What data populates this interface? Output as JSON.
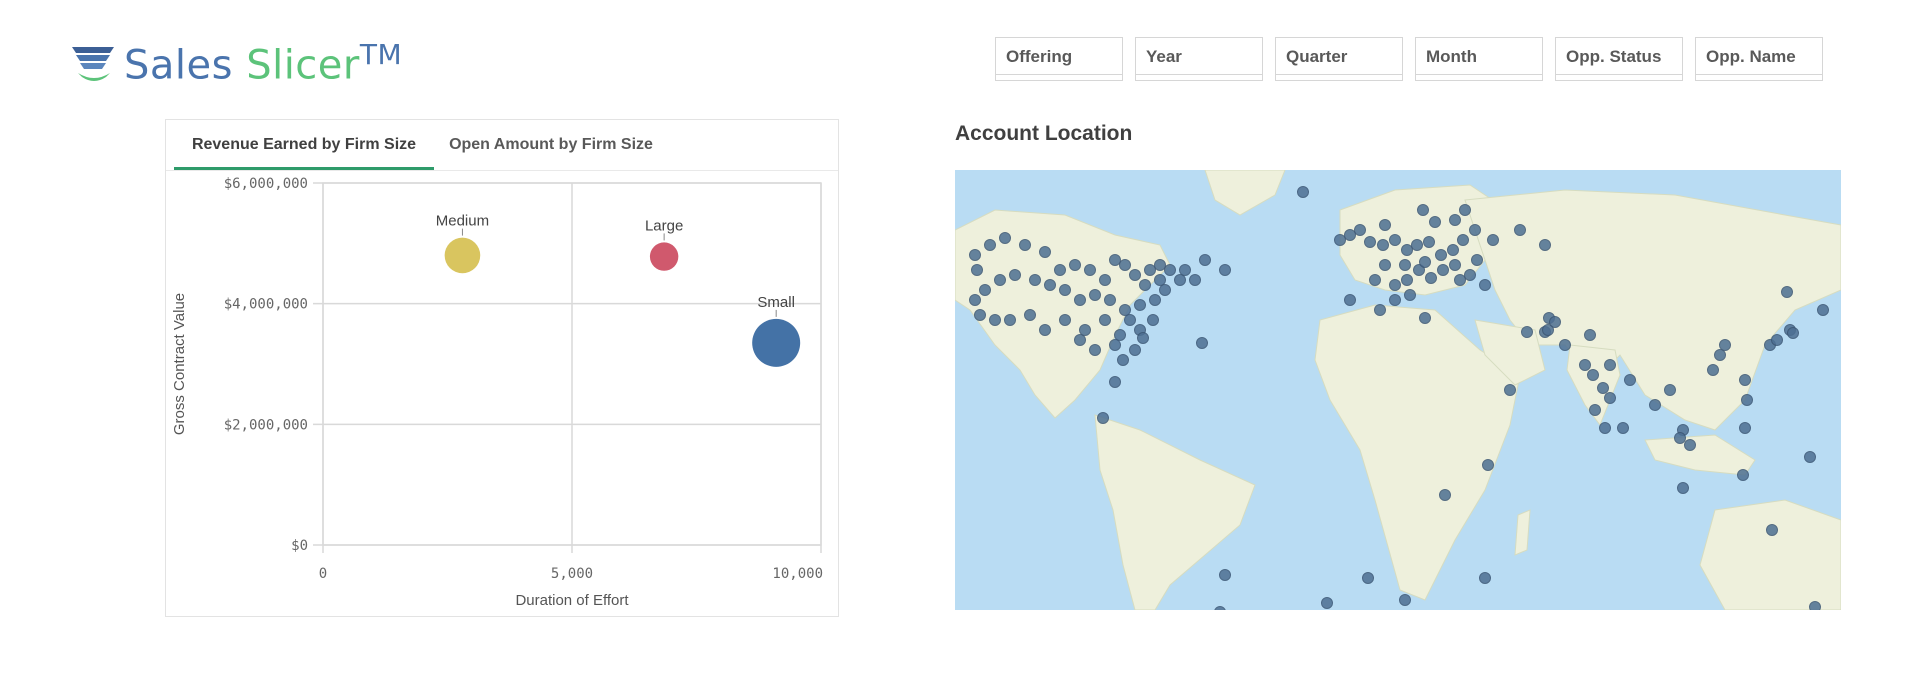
{
  "brand": {
    "part1": "Sales ",
    "part2": "Slicer",
    "tm": "TM"
  },
  "filters": [
    {
      "label": "Offering"
    },
    {
      "label": "Year"
    },
    {
      "label": "Quarter"
    },
    {
      "label": "Month"
    },
    {
      "label": "Opp. Status"
    },
    {
      "label": "Opp. Name"
    }
  ],
  "tabs": [
    {
      "label": "Revenue Earned by Firm Size",
      "active": true
    },
    {
      "label": "Open Amount by Firm Size",
      "active": false
    }
  ],
  "map": {
    "title": "Account Location"
  },
  "colors": {
    "accent": "#2e9b6a",
    "small": "#4472a6",
    "medium": "#d9c55f",
    "large": "#d0596d",
    "water": "#b9dcf3",
    "land": "#eef0dc",
    "dot": "#4d6f92"
  },
  "chart_data": {
    "type": "scatter",
    "xlabel": "Duration of Effort",
    "ylabel": "Gross Contract Value",
    "xlim": [
      0,
      10000
    ],
    "ylim": [
      0,
      6000000
    ],
    "xticks": [
      {
        "v": 0,
        "label": "0"
      },
      {
        "v": 5000,
        "label": "5,000"
      },
      {
        "v": 10000,
        "label": "10,000"
      }
    ],
    "yticks": [
      {
        "v": 0,
        "label": "$0"
      },
      {
        "v": 2000000,
        "label": "$2,000,000"
      },
      {
        "v": 4000000,
        "label": "$4,000,000"
      },
      {
        "v": 6000000,
        "label": "$6,000,000"
      }
    ],
    "grid": true,
    "points": [
      {
        "label": "Medium",
        "x": 2800,
        "y": 4800000,
        "size": 0.55,
        "color": "#d9c55f"
      },
      {
        "label": "Large",
        "x": 6850,
        "y": 4780000,
        "size": 0.35,
        "color": "#d0596d"
      },
      {
        "label": "Small",
        "x": 9100,
        "y": 3350000,
        "size": 1.0,
        "color": "#4472a6"
      }
    ]
  }
}
